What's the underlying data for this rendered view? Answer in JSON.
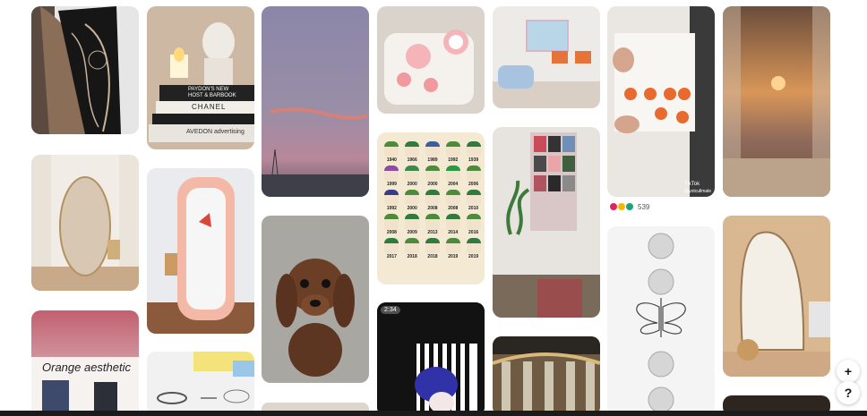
{
  "pins": {
    "books": {
      "titles": [
        "PAYDON'S NEW",
        "HOST & BARBOOK",
        "CHANEL",
        "AVEDON advertising"
      ]
    },
    "joker_years": [
      "1940",
      "1966",
      "1989",
      "1992",
      "1939",
      "1999",
      "2000",
      "2000",
      "2004",
      "2006",
      "1992",
      "2000",
      "2008",
      "2008",
      "2010",
      "2008",
      "2009",
      "2013",
      "2014",
      "2016",
      "2017",
      "2018",
      "2018",
      "2019",
      "2019"
    ],
    "orange_pin": {
      "title": "Orange aesthetic"
    },
    "stripe_pin": {
      "badge": "2:34"
    },
    "tiktok_pin": {
      "label": "TikTok",
      "user": "@yotcullmale"
    }
  },
  "reactions": {
    "count": "539"
  },
  "controls": {
    "add_label": "+",
    "help_label": "?"
  },
  "colors": {
    "bg": "#ffffff",
    "bar": "#1b1b1b"
  }
}
